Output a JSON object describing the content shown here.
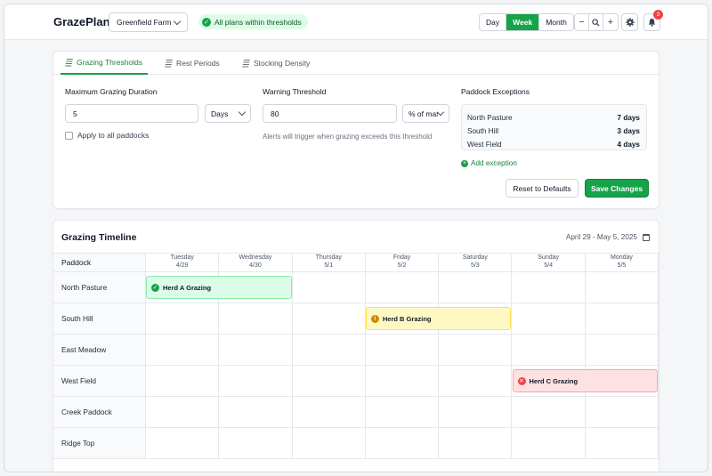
{
  "app": {
    "brand": "GrazePlan"
  },
  "header": {
    "farm_select": "Greenfield Farm",
    "status_text": "All plans within thresholds",
    "views": [
      "Day",
      "Week",
      "Month"
    ],
    "active_view": "Week",
    "zoom_out": "−",
    "zoom_search": "⌕",
    "zoom_in": "+",
    "notification_count": "3"
  },
  "settings": {
    "tabs": [
      {
        "label": "Grazing Thresholds",
        "active": true
      },
      {
        "label": "Rest Periods",
        "active": false
      },
      {
        "label": "Stocking Density",
        "active": false
      }
    ],
    "max_duration": {
      "label": "Maximum Grazing Duration",
      "value": "5",
      "unit": "Days"
    },
    "apply_all": "Apply to all paddocks",
    "warning": {
      "label": "Warning Threshold",
      "value": "80",
      "unit": "% of max",
      "hint": "Alerts will trigger when grazing exceeds this threshold"
    },
    "exceptions": {
      "label": "Paddock Exceptions",
      "items": [
        {
          "name": "North Pasture",
          "value": "7 days"
        },
        {
          "name": "South Hill",
          "value": "3 days"
        },
        {
          "name": "West Field",
          "value": "4 days"
        }
      ],
      "add_label": "Add exception"
    },
    "reset_label": "Reset to Defaults",
    "save_label": "Save Changes"
  },
  "timeline": {
    "title": "Grazing Timeline",
    "range": "April 29 - May 5, 2025",
    "paddock_header": "Paddock",
    "days": [
      {
        "name": "Tuesday",
        "date": "4/29"
      },
      {
        "name": "Wednesday",
        "date": "4/30"
      },
      {
        "name": "Thursday",
        "date": "5/1"
      },
      {
        "name": "Friday",
        "date": "5/2"
      },
      {
        "name": "Saturday",
        "date": "5/3"
      },
      {
        "name": "Sunday",
        "date": "5/4"
      },
      {
        "name": "Monday",
        "date": "5/5"
      }
    ],
    "paddocks": [
      "North Pasture",
      "South Hill",
      "East Meadow",
      "West Field",
      "Creek Paddock",
      "Ridge Top"
    ],
    "events": [
      {
        "label": "Herd A Grazing",
        "status": "ok"
      },
      {
        "label": "Herd B Grazing",
        "status": "warning"
      },
      {
        "label": "Herd C Grazing",
        "status": "exceeded"
      }
    ]
  },
  "colors": {
    "accent": "#16a34a",
    "warning": "#eab308",
    "danger": "#ef4444"
  }
}
